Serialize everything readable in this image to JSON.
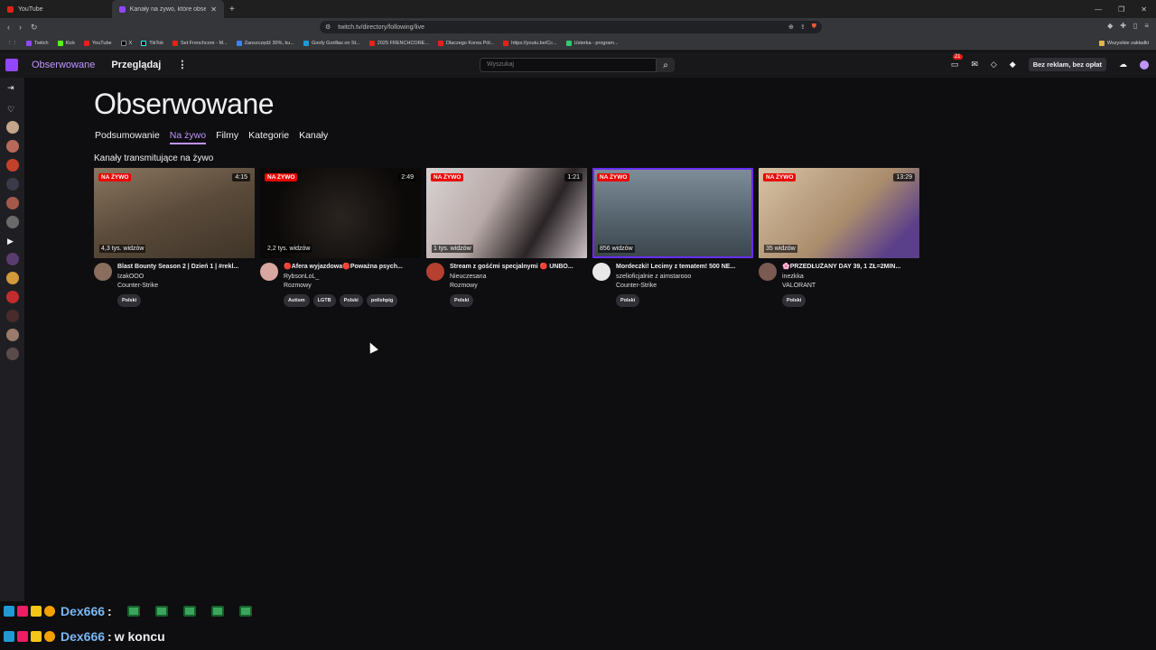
{
  "browser": {
    "tabs": [
      {
        "label": "YouTube",
        "active": false
      },
      {
        "label": "Kanały na żywo, które obserwuję",
        "active": true
      }
    ],
    "url": "twitch.tv/directory/following/live",
    "bookmarks": [
      "Twitch",
      "Kick",
      "YouTube",
      "X",
      "TikTok",
      "Set Frenchcore - M...",
      "Zaoszczędź 30%, ku...",
      "Goofy Gorillas on St...",
      "2025 FRENCHCORE...",
      "Dlaczego Korea Pół...",
      "https://youtu.be/Cc...",
      "Usterka - program..."
    ],
    "bookmarks_folder": "Wszystkie zakładki"
  },
  "topnav": {
    "following": "Obserwowane",
    "browse": "Przeglądaj",
    "more": "⋮",
    "search_placeholder": "Wyszukaj",
    "notif_count": "21",
    "adfree": "Bez reklam, bez opłat"
  },
  "page": {
    "title": "Obserwowane",
    "tabs": [
      {
        "label": "Podsumowanie",
        "active": false
      },
      {
        "label": "Na żywo",
        "active": true
      },
      {
        "label": "Filmy",
        "active": false
      },
      {
        "label": "Kategorie",
        "active": false
      },
      {
        "label": "Kanały",
        "active": false
      }
    ],
    "section_title": "Kanały transmitujące na żywo",
    "live_label": "NA ŻYWO"
  },
  "streams": [
    {
      "title": "Blast Bounty Season 2 | Dzień 1 | #rekl...",
      "channel": "IzakOOO",
      "category": "Counter-Strike",
      "viewers": "4,3 tys. widzów",
      "duration": "4:15",
      "tags": [
        "Polski"
      ],
      "thumb": "#6d5a44",
      "avatar": "#8a6d5c"
    },
    {
      "title": "🔴Afera wyjazdowa🔴Poważna psych...",
      "channel": "RybsonLoL_",
      "category": "Rozmowy",
      "viewers": "2,2 tys. widzów",
      "duration": "2:49",
      "tags": [
        "Autism",
        "LGTB",
        "Polski",
        "polishpig"
      ],
      "thumb": "#141210",
      "avatar": "#d8a7a0"
    },
    {
      "title": "Stream z gośćmi specjalnymi 🔴 UNBO...",
      "channel": "Nieuczesana",
      "category": "Rozmowy",
      "viewers": "1 tys. widzów",
      "duration": "1:21",
      "tags": [
        "Polski"
      ],
      "thumb": "#c8bcb8",
      "avatar": "#b5402f"
    },
    {
      "title": "Mordeczki! Lecimy z tematem! 500 NE...",
      "channel": "szelioficjalnie",
      "category": "Counter-Strike",
      "viewers": "856 widzów",
      "duration": "",
      "with": "z aimstarooo",
      "tags": [
        "Polski"
      ],
      "thumb": "#5f6e78",
      "avatar": "#e8e8e8"
    },
    {
      "title": "🌸PRZEDŁUŻANY DAY 39, 1 ZŁ=2MIN...",
      "channel": "inezkka",
      "category": "VALORANT",
      "viewers": "35 widzów",
      "duration": "13:29",
      "tags": [
        "Polski"
      ],
      "thumb": "#b39a82",
      "avatar": "#7b5a52"
    }
  ],
  "chat": [
    {
      "name": "Dex666",
      "sep": ":",
      "message": ""
    },
    {
      "name": "Dex666",
      "sep": ":",
      "message": "w koncu"
    }
  ]
}
